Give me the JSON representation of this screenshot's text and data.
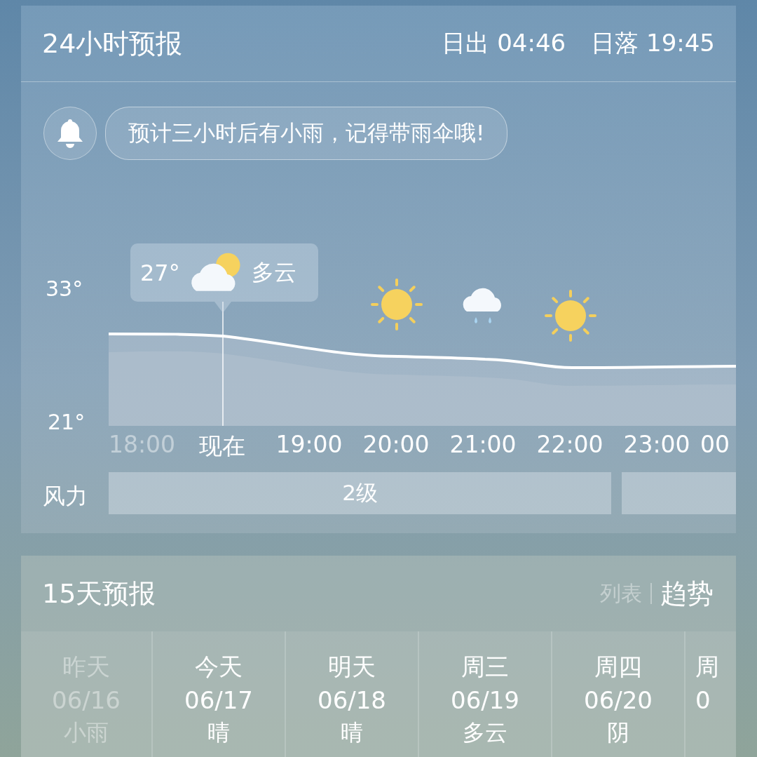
{
  "forecast_24h": {
    "title": "24小时预报",
    "sunrise": {
      "label": "日出",
      "time": "04:46"
    },
    "sunset": {
      "label": "日落",
      "time": "19:45"
    },
    "alert": {
      "message": "预计三小时后有小雨，记得带雨伞哦!"
    },
    "chart": {
      "y_max_label": "33°",
      "y_min_label": "21°"
    },
    "hours": [
      {
        "label": "18:00",
        "past": true
      },
      {
        "label": "现在",
        "past": false,
        "tooltip": {
          "temperature": "27°",
          "condition": "多云",
          "kind": "partly-cloudy"
        }
      },
      {
        "label": "19:00",
        "past": false
      },
      {
        "label": "20:00",
        "past": false,
        "kind": "sun"
      },
      {
        "label": "21:00",
        "past": false,
        "kind": "rain"
      },
      {
        "label": "22:00",
        "past": false,
        "kind": "sun"
      },
      {
        "label": "23:00",
        "past": false
      },
      {
        "label": "00",
        "past": false
      }
    ],
    "wind": {
      "label": "风力",
      "segments": [
        "2级"
      ]
    }
  },
  "forecast_15d": {
    "title": "15天预报",
    "views": [
      {
        "label": "列表",
        "selected": false
      },
      {
        "label": "趋势",
        "selected": true
      }
    ],
    "days": [
      {
        "day": "昨天",
        "date": "06/16",
        "condition": "小雨",
        "past": true
      },
      {
        "day": "今天",
        "date": "06/17",
        "condition": "晴",
        "past": false
      },
      {
        "day": "明天",
        "date": "06/18",
        "condition": "晴",
        "past": false
      },
      {
        "day": "周三",
        "date": "06/19",
        "condition": "多云",
        "past": false
      },
      {
        "day": "周四",
        "date": "06/20",
        "condition": "阴",
        "past": false
      },
      {
        "day": "周",
        "date": "0",
        "past": false
      }
    ]
  }
}
